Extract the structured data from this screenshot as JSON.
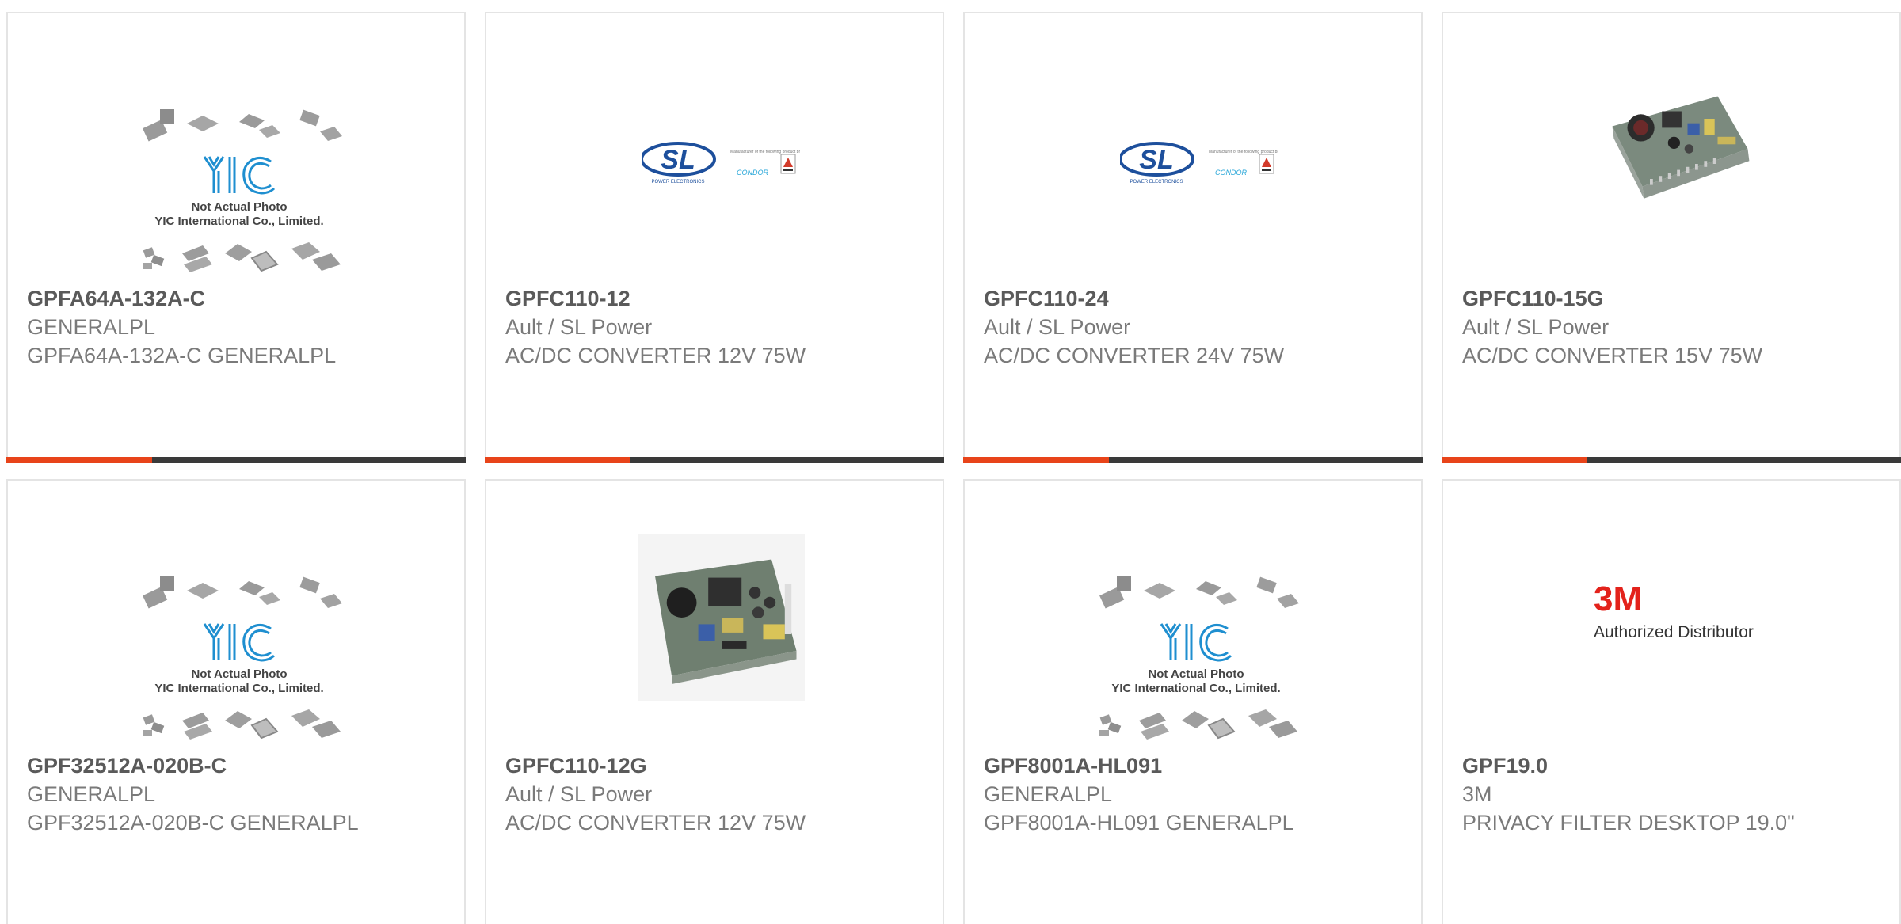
{
  "colors": {
    "accent": "#e8441a",
    "bar": "#3a3a3a",
    "yic_blue": "#1f8fd0",
    "sl_blue": "#1d4f9c",
    "condor_cyan": "#27a6d8",
    "m3_red": "#e3221b"
  },
  "images": {
    "yic": {
      "caption_line1": "Not Actual Photo",
      "caption_line2": "YIC International Co., Limited."
    },
    "sl": {
      "logo": "SL",
      "sub": "POWER ELECTRONICS",
      "condor": "CONDOR",
      "manufacturer_note": "Manufacturer of the following product brands"
    },
    "m3": {
      "logo": "3M",
      "tagline": "Authorized Distributor"
    }
  },
  "products": [
    {
      "part": "GPFA64A-132A-C",
      "manufacturer": "GENERALPL",
      "description": "GPFA64A-132A-C GENERALPL",
      "image": "yic"
    },
    {
      "part": "GPFC110-12",
      "manufacturer": "Ault / SL Power",
      "description": "AC/DC CONVERTER 12V 75W",
      "image": "sl"
    },
    {
      "part": "GPFC110-24",
      "manufacturer": "Ault / SL Power",
      "description": "AC/DC CONVERTER 24V 75W",
      "image": "sl"
    },
    {
      "part": "GPFC110-15G",
      "manufacturer": "Ault / SL Power",
      "description": "AC/DC CONVERTER 15V 75W",
      "image": "psu"
    },
    {
      "part": "GPF32512A-020B-C",
      "manufacturer": "GENERALPL",
      "description": "GPF32512A-020B-C GENERALPL",
      "image": "yic"
    },
    {
      "part": "GPFC110-12G",
      "manufacturer": "Ault / SL Power",
      "description": "AC/DC CONVERTER 12V 75W",
      "image": "psu2"
    },
    {
      "part": "GPF8001A-HL091",
      "manufacturer": "GENERALPL",
      "description": "GPF8001A-HL091 GENERALPL",
      "image": "yic"
    },
    {
      "part": "GPF19.0",
      "manufacturer": "3M",
      "description": "PRIVACY FILTER DESKTOP 19.0\"",
      "image": "m3"
    }
  ]
}
